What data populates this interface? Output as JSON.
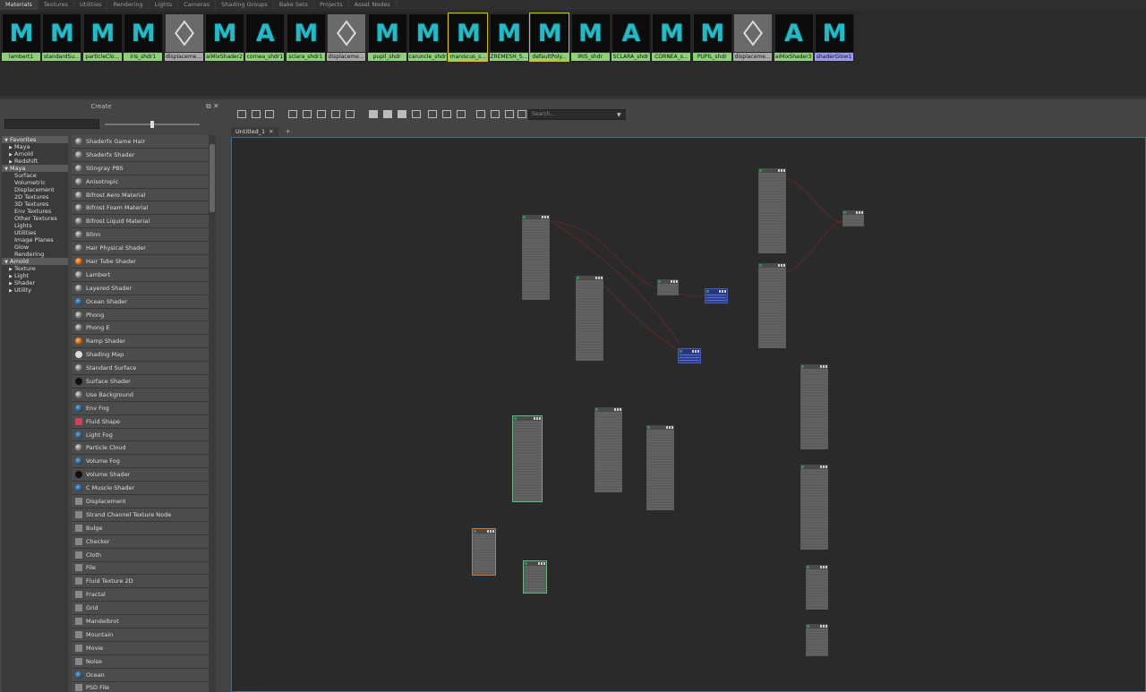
{
  "top_tabs": [
    "Materials",
    "Textures",
    "Utilities",
    "Rendering",
    "Lights",
    "Cameras",
    "Shading Groups",
    "Bake Sets",
    "Projects",
    "Asset Nodes"
  ],
  "swatches": [
    {
      "label": "lambert1",
      "icon": "M",
      "kind": "maya"
    },
    {
      "label": "standardSu...",
      "icon": "M",
      "kind": "maya"
    },
    {
      "label": "particleClo...",
      "icon": "M",
      "kind": "maya"
    },
    {
      "label": "iris_shdr1",
      "icon": "M",
      "kind": "maya"
    },
    {
      "label": "displaceme...",
      "icon": "cube",
      "kind": "gray"
    },
    {
      "label": "aiMixShader2",
      "icon": "M",
      "kind": "maya"
    },
    {
      "label": "cornea_shdr1",
      "icon": "A",
      "kind": "arnold"
    },
    {
      "label": "sclara_shdr1",
      "icon": "M",
      "kind": "maya"
    },
    {
      "label": "displaceme...",
      "icon": "cube",
      "kind": "gray"
    },
    {
      "label": "pupil_shdr",
      "icon": "M",
      "kind": "maya"
    },
    {
      "label": "caruncle_shdr",
      "icon": "M",
      "kind": "maya"
    },
    {
      "label": "maniscus_s...",
      "icon": "M",
      "kind": "maya",
      "selected": true
    },
    {
      "label": "ZREMESH_S...",
      "icon": "M",
      "kind": "maya"
    },
    {
      "label": "defaultPoly...",
      "icon": "M",
      "kind": "maya",
      "selected": true
    },
    {
      "label": "IRIS_shdr",
      "icon": "M",
      "kind": "maya"
    },
    {
      "label": "SCLARA_shdr",
      "icon": "A",
      "kind": "arnold"
    },
    {
      "label": "CORNEA_s...",
      "icon": "M",
      "kind": "maya"
    },
    {
      "label": "PUPIL_shdr",
      "icon": "M",
      "kind": "maya"
    },
    {
      "label": "displaceme...",
      "icon": "cube",
      "kind": "gray"
    },
    {
      "label": "aiMixShader3",
      "icon": "A",
      "kind": "arnold"
    },
    {
      "label": "shaderGlow1",
      "icon": "M",
      "kind": "glow"
    }
  ],
  "create_panel": {
    "title": "Create",
    "search_value": "",
    "categories": [
      {
        "label": "Favorites",
        "level": 0,
        "header": true,
        "expanded": true
      },
      {
        "label": "Maya",
        "level": 1,
        "arrow": true
      },
      {
        "label": "Arnold",
        "level": 1,
        "arrow": true
      },
      {
        "label": "Redshift",
        "level": 1,
        "arrow": true
      },
      {
        "label": "Maya",
        "level": 0,
        "header": true,
        "expanded": true
      },
      {
        "label": "Surface",
        "level": 2
      },
      {
        "label": "Volumetric",
        "level": 2
      },
      {
        "label": "Displacement",
        "level": 2
      },
      {
        "label": "2D Textures",
        "level": 2
      },
      {
        "label": "3D Textures",
        "level": 2
      },
      {
        "label": "Env Textures",
        "level": 2
      },
      {
        "label": "Other Textures",
        "level": 2
      },
      {
        "label": "Lights",
        "level": 2
      },
      {
        "label": "Utilities",
        "level": 2
      },
      {
        "label": "Image Planes",
        "level": 2
      },
      {
        "label": "Glow",
        "level": 2
      },
      {
        "label": "Rendering",
        "level": 2
      },
      {
        "label": "Arnold",
        "level": 0,
        "header": true,
        "expanded": true
      },
      {
        "label": "Texture",
        "level": 1,
        "arrow": true
      },
      {
        "label": "Light",
        "level": 1,
        "arrow": true
      },
      {
        "label": "Shader",
        "level": 1,
        "arrow": true
      },
      {
        "label": "Utility",
        "level": 1,
        "arrow": true
      }
    ],
    "nodes": [
      {
        "label": "Shaderfx Game Hair",
        "icon": "sphere"
      },
      {
        "label": "Shaderfx Shader",
        "icon": "sphere"
      },
      {
        "label": "Stingray PBS",
        "icon": "sphere"
      },
      {
        "label": "Anisotropic",
        "icon": "sphere"
      },
      {
        "label": "Bifrost Aero Material",
        "icon": "sphere"
      },
      {
        "label": "Bifrost Foam Material",
        "icon": "sphere"
      },
      {
        "label": "Bifrost Liquid Material",
        "icon": "sphere"
      },
      {
        "label": "Blinn",
        "icon": "sphere"
      },
      {
        "label": "Hair Physical Shader",
        "icon": "sphere"
      },
      {
        "label": "Hair Tube Shader",
        "icon": "orange"
      },
      {
        "label": "Lambert",
        "icon": "sphere"
      },
      {
        "label": "Layered Shader",
        "icon": "sphere"
      },
      {
        "label": "Ocean Shader",
        "icon": "teal"
      },
      {
        "label": "Phong",
        "icon": "sphere"
      },
      {
        "label": "Phong E",
        "icon": "sphere"
      },
      {
        "label": "Ramp Shader",
        "icon": "orange"
      },
      {
        "label": "Shading Map",
        "icon": "white"
      },
      {
        "label": "Standard Surface",
        "icon": "sphere"
      },
      {
        "label": "Surface Shader",
        "icon": "black"
      },
      {
        "label": "Use Background",
        "icon": "sphere"
      },
      {
        "label": "Env Fog",
        "icon": "teal"
      },
      {
        "label": "Fluid Shape",
        "icon": "red"
      },
      {
        "label": "Light Fog",
        "icon": "teal"
      },
      {
        "label": "Particle Cloud",
        "icon": "sphere"
      },
      {
        "label": "Volume Fog",
        "icon": "teal"
      },
      {
        "label": "Volume Shader",
        "icon": "black"
      },
      {
        "label": "C Muscle Shader",
        "icon": "teal"
      },
      {
        "label": "Displacement",
        "icon": "square"
      },
      {
        "label": "Strand Channel Texture Node",
        "icon": "square"
      },
      {
        "label": "Bulge",
        "icon": "square"
      },
      {
        "label": "Checker",
        "icon": "square"
      },
      {
        "label": "Cloth",
        "icon": "square"
      },
      {
        "label": "File",
        "icon": "square"
      },
      {
        "label": "Fluid Texture 2D",
        "icon": "square"
      },
      {
        "label": "Fractal",
        "icon": "square"
      },
      {
        "label": "Grid",
        "icon": "square"
      },
      {
        "label": "Mandelbrot",
        "icon": "square"
      },
      {
        "label": "Mountain",
        "icon": "square"
      },
      {
        "label": "Movie",
        "icon": "square"
      },
      {
        "label": "Noise",
        "icon": "square"
      },
      {
        "label": "Ocean",
        "icon": "teal"
      },
      {
        "label": "PSD File",
        "icon": "square"
      }
    ]
  },
  "editor": {
    "search_placeholder": "Search...",
    "tabs": [
      {
        "label": "Untitled_1",
        "active": true
      }
    ],
    "add_tab": "+"
  },
  "colors": {
    "maya_icon": "#28b8c4",
    "label_green": "#8fd17a",
    "label_gray": "#a8a8a8",
    "label_blue": "#9a9ae8",
    "selected_swatch": "#c9b73a",
    "wire": "#8a2a2a",
    "node_blue": "#2b3e8f"
  }
}
